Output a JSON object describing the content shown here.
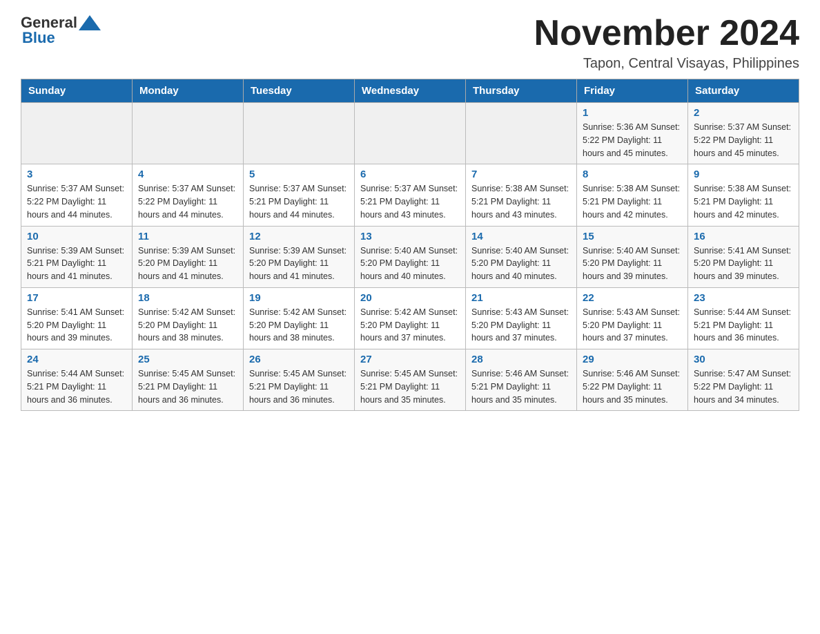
{
  "header": {
    "logo": {
      "general": "General",
      "blue": "Blue",
      "tagline": "Blue"
    },
    "title": "November 2024",
    "subtitle": "Tapon, Central Visayas, Philippines"
  },
  "days_of_week": [
    "Sunday",
    "Monday",
    "Tuesday",
    "Wednesday",
    "Thursday",
    "Friday",
    "Saturday"
  ],
  "weeks": [
    {
      "days": [
        {
          "number": "",
          "info": ""
        },
        {
          "number": "",
          "info": ""
        },
        {
          "number": "",
          "info": ""
        },
        {
          "number": "",
          "info": ""
        },
        {
          "number": "",
          "info": ""
        },
        {
          "number": "1",
          "info": "Sunrise: 5:36 AM\nSunset: 5:22 PM\nDaylight: 11 hours\nand 45 minutes."
        },
        {
          "number": "2",
          "info": "Sunrise: 5:37 AM\nSunset: 5:22 PM\nDaylight: 11 hours\nand 45 minutes."
        }
      ]
    },
    {
      "days": [
        {
          "number": "3",
          "info": "Sunrise: 5:37 AM\nSunset: 5:22 PM\nDaylight: 11 hours\nand 44 minutes."
        },
        {
          "number": "4",
          "info": "Sunrise: 5:37 AM\nSunset: 5:22 PM\nDaylight: 11 hours\nand 44 minutes."
        },
        {
          "number": "5",
          "info": "Sunrise: 5:37 AM\nSunset: 5:21 PM\nDaylight: 11 hours\nand 44 minutes."
        },
        {
          "number": "6",
          "info": "Sunrise: 5:37 AM\nSunset: 5:21 PM\nDaylight: 11 hours\nand 43 minutes."
        },
        {
          "number": "7",
          "info": "Sunrise: 5:38 AM\nSunset: 5:21 PM\nDaylight: 11 hours\nand 43 minutes."
        },
        {
          "number": "8",
          "info": "Sunrise: 5:38 AM\nSunset: 5:21 PM\nDaylight: 11 hours\nand 42 minutes."
        },
        {
          "number": "9",
          "info": "Sunrise: 5:38 AM\nSunset: 5:21 PM\nDaylight: 11 hours\nand 42 minutes."
        }
      ]
    },
    {
      "days": [
        {
          "number": "10",
          "info": "Sunrise: 5:39 AM\nSunset: 5:21 PM\nDaylight: 11 hours\nand 41 minutes."
        },
        {
          "number": "11",
          "info": "Sunrise: 5:39 AM\nSunset: 5:20 PM\nDaylight: 11 hours\nand 41 minutes."
        },
        {
          "number": "12",
          "info": "Sunrise: 5:39 AM\nSunset: 5:20 PM\nDaylight: 11 hours\nand 41 minutes."
        },
        {
          "number": "13",
          "info": "Sunrise: 5:40 AM\nSunset: 5:20 PM\nDaylight: 11 hours\nand 40 minutes."
        },
        {
          "number": "14",
          "info": "Sunrise: 5:40 AM\nSunset: 5:20 PM\nDaylight: 11 hours\nand 40 minutes."
        },
        {
          "number": "15",
          "info": "Sunrise: 5:40 AM\nSunset: 5:20 PM\nDaylight: 11 hours\nand 39 minutes."
        },
        {
          "number": "16",
          "info": "Sunrise: 5:41 AM\nSunset: 5:20 PM\nDaylight: 11 hours\nand 39 minutes."
        }
      ]
    },
    {
      "days": [
        {
          "number": "17",
          "info": "Sunrise: 5:41 AM\nSunset: 5:20 PM\nDaylight: 11 hours\nand 39 minutes."
        },
        {
          "number": "18",
          "info": "Sunrise: 5:42 AM\nSunset: 5:20 PM\nDaylight: 11 hours\nand 38 minutes."
        },
        {
          "number": "19",
          "info": "Sunrise: 5:42 AM\nSunset: 5:20 PM\nDaylight: 11 hours\nand 38 minutes."
        },
        {
          "number": "20",
          "info": "Sunrise: 5:42 AM\nSunset: 5:20 PM\nDaylight: 11 hours\nand 37 minutes."
        },
        {
          "number": "21",
          "info": "Sunrise: 5:43 AM\nSunset: 5:20 PM\nDaylight: 11 hours\nand 37 minutes."
        },
        {
          "number": "22",
          "info": "Sunrise: 5:43 AM\nSunset: 5:20 PM\nDaylight: 11 hours\nand 37 minutes."
        },
        {
          "number": "23",
          "info": "Sunrise: 5:44 AM\nSunset: 5:21 PM\nDaylight: 11 hours\nand 36 minutes."
        }
      ]
    },
    {
      "days": [
        {
          "number": "24",
          "info": "Sunrise: 5:44 AM\nSunset: 5:21 PM\nDaylight: 11 hours\nand 36 minutes."
        },
        {
          "number": "25",
          "info": "Sunrise: 5:45 AM\nSunset: 5:21 PM\nDaylight: 11 hours\nand 36 minutes."
        },
        {
          "number": "26",
          "info": "Sunrise: 5:45 AM\nSunset: 5:21 PM\nDaylight: 11 hours\nand 36 minutes."
        },
        {
          "number": "27",
          "info": "Sunrise: 5:45 AM\nSunset: 5:21 PM\nDaylight: 11 hours\nand 35 minutes."
        },
        {
          "number": "28",
          "info": "Sunrise: 5:46 AM\nSunset: 5:21 PM\nDaylight: 11 hours\nand 35 minutes."
        },
        {
          "number": "29",
          "info": "Sunrise: 5:46 AM\nSunset: 5:22 PM\nDaylight: 11 hours\nand 35 minutes."
        },
        {
          "number": "30",
          "info": "Sunrise: 5:47 AM\nSunset: 5:22 PM\nDaylight: 11 hours\nand 34 minutes."
        }
      ]
    }
  ]
}
